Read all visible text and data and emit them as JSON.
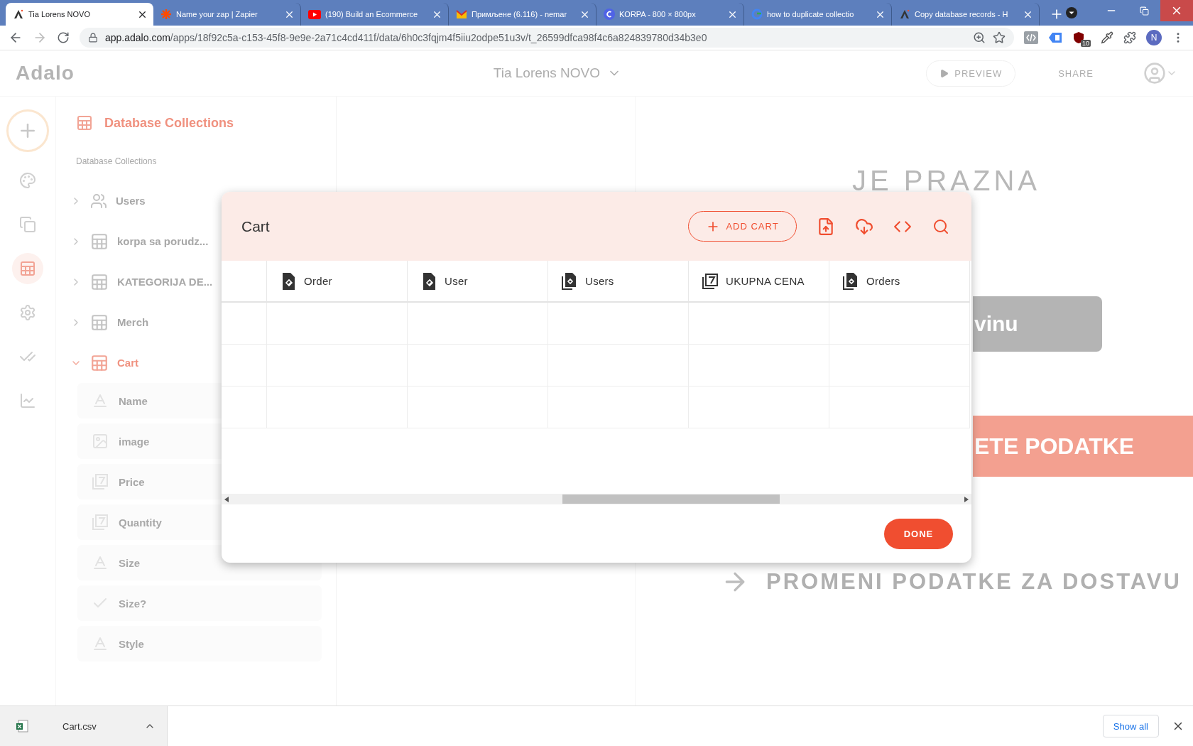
{
  "browser": {
    "tabs": [
      {
        "title": "Tia Lorens NOVO",
        "selected": true
      },
      {
        "title": "Name your zap | Zapier",
        "selected": false
      },
      {
        "title": "(190) Build an Ecommerce",
        "selected": false
      },
      {
        "title": "Примљене (6.116) - nemar",
        "selected": false
      },
      {
        "title": "KORPA - 800 × 800px",
        "selected": false
      },
      {
        "title": "how to duplicate collectio",
        "selected": false
      },
      {
        "title": "Copy database records - H",
        "selected": false
      }
    ],
    "url_host": "app.adalo.com",
    "url_path": "/apps/18f92c5a-c153-45f8-9e9e-2a71c4cd411f/data/6h0c3fqjm4f5iiu2odpe51u3v/t_26599dfca98f4c6a824839780d34b3e0",
    "extension_badge": "10",
    "profile_initial": "N"
  },
  "header": {
    "logo": "Adalo",
    "app_name": "Tia Lorens NOVO",
    "preview": "PREVIEW",
    "share": "SHARE"
  },
  "rail": [
    {
      "kind": "palette",
      "selected": false
    },
    {
      "kind": "screens",
      "selected": false
    },
    {
      "kind": "database",
      "selected": true
    },
    {
      "kind": "settings",
      "selected": false
    },
    {
      "kind": "checks",
      "selected": false
    },
    {
      "kind": "analytics",
      "selected": false
    }
  ],
  "sidebar": {
    "title": "Database Collections",
    "section": "Database Collections",
    "collections": [
      {
        "name": "Users",
        "kind": "users",
        "expanded": false,
        "selected": false
      },
      {
        "name": "korpa sa porudz...",
        "kind": "table",
        "expanded": false,
        "selected": false
      },
      {
        "name": "KATEGORIJA DE...",
        "kind": "table",
        "expanded": false,
        "selected": false
      },
      {
        "name": "Merch",
        "kind": "table",
        "expanded": false,
        "selected": false
      },
      {
        "name": "Cart",
        "kind": "table",
        "expanded": true,
        "selected": true,
        "children": [
          {
            "name": "Name",
            "kind": "text"
          },
          {
            "name": "image",
            "kind": "image"
          },
          {
            "name": "Price",
            "kind": "number"
          },
          {
            "name": "Quantity",
            "kind": "number"
          },
          {
            "name": "Size",
            "kind": "text"
          },
          {
            "name": "Size?",
            "kind": "boolean"
          },
          {
            "name": "Style",
            "kind": "text"
          }
        ]
      }
    ]
  },
  "preview": {
    "heading": "JE PRAZNA",
    "button_1": "vinu",
    "button_2": "ETE PODATKE",
    "link": "PROMENI PODATKE ZA DOSTAVU"
  },
  "dialog": {
    "title": "Cart",
    "add_button": "ADD CART",
    "columns": [
      {
        "label": "Order",
        "kind": "relation"
      },
      {
        "label": "User",
        "kind": "relation"
      },
      {
        "label": "Users",
        "kind": "relation-many"
      },
      {
        "label": "UKUPNA CENA",
        "kind": "number"
      },
      {
        "label": "Orders",
        "kind": "relation-many"
      }
    ],
    "done": "DONE"
  },
  "downloads": {
    "file": "Cart.csv",
    "show_all": "Show all"
  }
}
